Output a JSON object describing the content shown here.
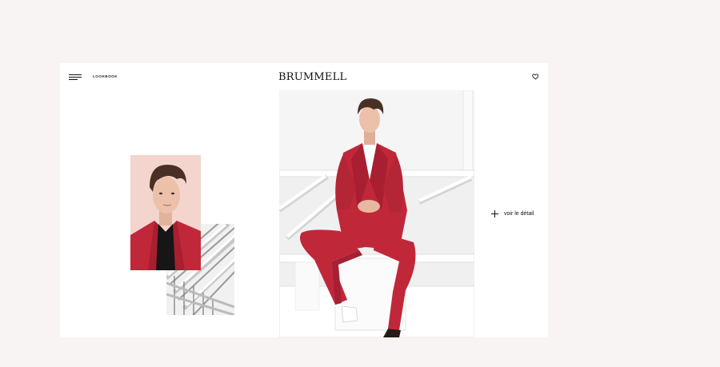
{
  "header": {
    "menu_icon": "hamburger-menu-icon",
    "nav_label": "LOOKBOOK",
    "logo": "BRUMMELL",
    "favorite_icon": "heart-icon"
  },
  "collage": {
    "portrait_alt": "",
    "architecture_alt": ""
  },
  "main": {
    "detail_icon": "plus-icon",
    "detail_label": "voir le détail"
  },
  "colors": {
    "background": "#f7f4f3",
    "card": "#ffffff",
    "suit_red": "#c0283a",
    "portrait_bg": "#f3d6cf"
  }
}
